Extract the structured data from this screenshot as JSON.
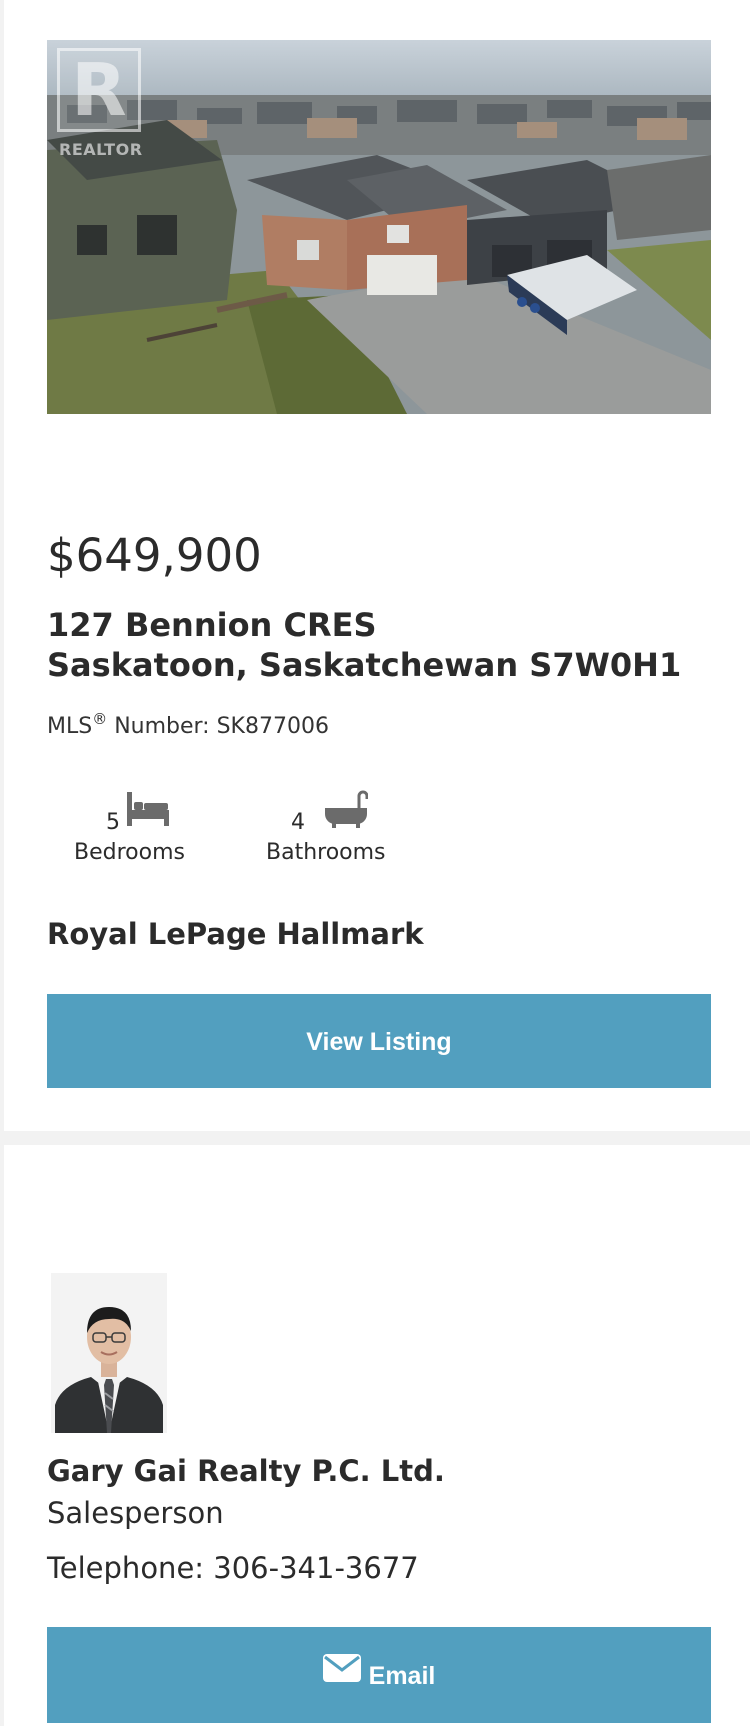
{
  "listing": {
    "photo_alt": "",
    "watermark": "REALTOR",
    "price": "$649,900",
    "address_line1": "127 Bennion CRES",
    "address_line2": "Saskatoon, Saskatchewan S7W0H1",
    "mls_label": "MLS",
    "mls_rest": " Number: SK877006",
    "bedrooms": {
      "count": "5",
      "label": "Bedrooms",
      "icon": "bed-icon"
    },
    "bathrooms": {
      "count": "4",
      "label": "Bathrooms",
      "icon": "bathtub-icon"
    },
    "brokerage": "Royal LePage Hallmark",
    "view_button": "View Listing"
  },
  "agent": {
    "name": "Gary Gai Realty P.C. Ltd.",
    "role": "Salesperson",
    "telephone_label": "Telephone:",
    "telephone": "306-341-3677",
    "email_button": "Email",
    "email_icon": "envelope-icon"
  },
  "colors": {
    "button": "#529fbf",
    "text": "#2b2b2b",
    "background": "#f2f2f2",
    "card": "#ffffff"
  }
}
